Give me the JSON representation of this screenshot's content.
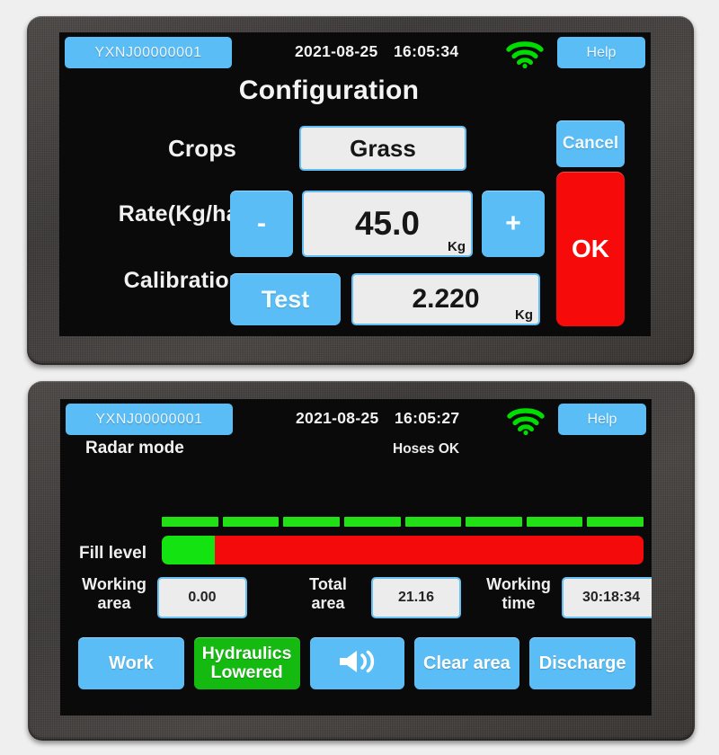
{
  "theme": {
    "bezel": "#3a3736",
    "screen_bg": "#0a0a0a",
    "accent_blue": "#5bbdf5",
    "value_bg": "#ececec",
    "ok_red": "#f70a0a",
    "bar_red": "#f40a0a",
    "bar_green": "#13e310",
    "wifi_green": "#00dd00",
    "hydraulics_green": "#15ba11",
    "page_bg": "#eeeeee"
  },
  "panel_config": {
    "status": {
      "serial": "YXNJ00000001",
      "date": "2021-08-25",
      "time": "16:05:34",
      "wifi_icon": "wifi-icon",
      "help_label": "Help"
    },
    "title": "Configuration",
    "rows": {
      "crops": {
        "label": "Crops",
        "value": "Grass"
      },
      "rate": {
        "label": "Rate(Kg/ha)",
        "minus_label": "-",
        "plus_label": "+",
        "value": "45.0",
        "unit": "Kg"
      },
      "calibration": {
        "label": "Calibration",
        "test_label": "Test",
        "value": "2.220",
        "unit": "Kg"
      }
    },
    "cancel_label": "Cancel",
    "ok_label": "OK"
  },
  "panel_operation": {
    "status": {
      "serial": "YXNJ00000001",
      "date": "2021-08-25",
      "time": "16:05:27",
      "wifi_icon": "wifi-icon",
      "help_label": "Help"
    },
    "mode_label": "Radar mode",
    "hoses_status": "Hoses OK",
    "fill_level": {
      "label": "Fill level",
      "percent": 11,
      "tick_count": 8
    },
    "stats": [
      {
        "caption": "Working\narea",
        "caption_line1": "Working",
        "caption_line2": "area",
        "value": "0.00"
      },
      {
        "caption": "Total\narea",
        "caption_line1": "Total",
        "caption_line2": "area",
        "value": "21.16"
      },
      {
        "caption": "Working\ntime",
        "caption_line1": "Working",
        "caption_line2": "time",
        "value": "30:18:34"
      }
    ],
    "actions": [
      {
        "label": "Work",
        "state": "normal",
        "icon": null
      },
      {
        "label": "Hydraulics\nLowered",
        "line1": "Hydraulics",
        "line2": "Lowered",
        "state": "active-green",
        "icon": null
      },
      {
        "label": "",
        "state": "normal",
        "icon": "speaker-volume-icon"
      },
      {
        "label": "Clear area",
        "state": "normal",
        "icon": null
      },
      {
        "label": "Discharge",
        "state": "normal",
        "icon": null
      }
    ]
  }
}
